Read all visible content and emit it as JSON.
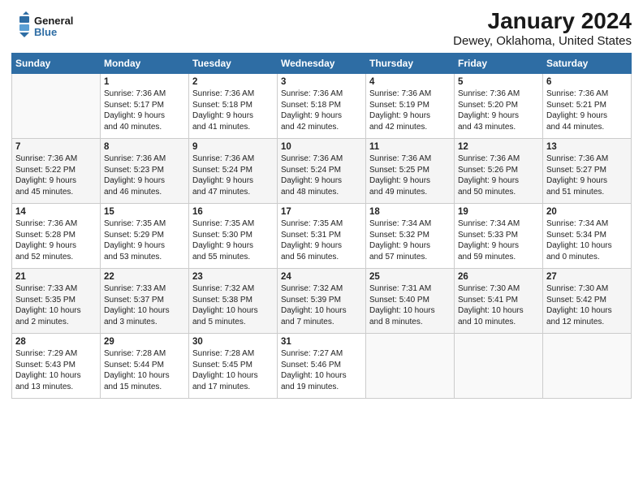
{
  "logo": {
    "line1": "General",
    "line2": "Blue"
  },
  "title": "January 2024",
  "subtitle": "Dewey, Oklahoma, United States",
  "header": {
    "accent_color": "#2e6da4"
  },
  "days_of_week": [
    "Sunday",
    "Monday",
    "Tuesday",
    "Wednesday",
    "Thursday",
    "Friday",
    "Saturday"
  ],
  "weeks": [
    [
      {
        "day": "",
        "content": ""
      },
      {
        "day": "1",
        "content": "Sunrise: 7:36 AM\nSunset: 5:17 PM\nDaylight: 9 hours\nand 40 minutes."
      },
      {
        "day": "2",
        "content": "Sunrise: 7:36 AM\nSunset: 5:18 PM\nDaylight: 9 hours\nand 41 minutes."
      },
      {
        "day": "3",
        "content": "Sunrise: 7:36 AM\nSunset: 5:18 PM\nDaylight: 9 hours\nand 42 minutes."
      },
      {
        "day": "4",
        "content": "Sunrise: 7:36 AM\nSunset: 5:19 PM\nDaylight: 9 hours\nand 42 minutes."
      },
      {
        "day": "5",
        "content": "Sunrise: 7:36 AM\nSunset: 5:20 PM\nDaylight: 9 hours\nand 43 minutes."
      },
      {
        "day": "6",
        "content": "Sunrise: 7:36 AM\nSunset: 5:21 PM\nDaylight: 9 hours\nand 44 minutes."
      }
    ],
    [
      {
        "day": "7",
        "content": "Sunrise: 7:36 AM\nSunset: 5:22 PM\nDaylight: 9 hours\nand 45 minutes."
      },
      {
        "day": "8",
        "content": "Sunrise: 7:36 AM\nSunset: 5:23 PM\nDaylight: 9 hours\nand 46 minutes."
      },
      {
        "day": "9",
        "content": "Sunrise: 7:36 AM\nSunset: 5:24 PM\nDaylight: 9 hours\nand 47 minutes."
      },
      {
        "day": "10",
        "content": "Sunrise: 7:36 AM\nSunset: 5:24 PM\nDaylight: 9 hours\nand 48 minutes."
      },
      {
        "day": "11",
        "content": "Sunrise: 7:36 AM\nSunset: 5:25 PM\nDaylight: 9 hours\nand 49 minutes."
      },
      {
        "day": "12",
        "content": "Sunrise: 7:36 AM\nSunset: 5:26 PM\nDaylight: 9 hours\nand 50 minutes."
      },
      {
        "day": "13",
        "content": "Sunrise: 7:36 AM\nSunset: 5:27 PM\nDaylight: 9 hours\nand 51 minutes."
      }
    ],
    [
      {
        "day": "14",
        "content": "Sunrise: 7:36 AM\nSunset: 5:28 PM\nDaylight: 9 hours\nand 52 minutes."
      },
      {
        "day": "15",
        "content": "Sunrise: 7:35 AM\nSunset: 5:29 PM\nDaylight: 9 hours\nand 53 minutes."
      },
      {
        "day": "16",
        "content": "Sunrise: 7:35 AM\nSunset: 5:30 PM\nDaylight: 9 hours\nand 55 minutes."
      },
      {
        "day": "17",
        "content": "Sunrise: 7:35 AM\nSunset: 5:31 PM\nDaylight: 9 hours\nand 56 minutes."
      },
      {
        "day": "18",
        "content": "Sunrise: 7:34 AM\nSunset: 5:32 PM\nDaylight: 9 hours\nand 57 minutes."
      },
      {
        "day": "19",
        "content": "Sunrise: 7:34 AM\nSunset: 5:33 PM\nDaylight: 9 hours\nand 59 minutes."
      },
      {
        "day": "20",
        "content": "Sunrise: 7:34 AM\nSunset: 5:34 PM\nDaylight: 10 hours\nand 0 minutes."
      }
    ],
    [
      {
        "day": "21",
        "content": "Sunrise: 7:33 AM\nSunset: 5:35 PM\nDaylight: 10 hours\nand 2 minutes."
      },
      {
        "day": "22",
        "content": "Sunrise: 7:33 AM\nSunset: 5:37 PM\nDaylight: 10 hours\nand 3 minutes."
      },
      {
        "day": "23",
        "content": "Sunrise: 7:32 AM\nSunset: 5:38 PM\nDaylight: 10 hours\nand 5 minutes."
      },
      {
        "day": "24",
        "content": "Sunrise: 7:32 AM\nSunset: 5:39 PM\nDaylight: 10 hours\nand 7 minutes."
      },
      {
        "day": "25",
        "content": "Sunrise: 7:31 AM\nSunset: 5:40 PM\nDaylight: 10 hours\nand 8 minutes."
      },
      {
        "day": "26",
        "content": "Sunrise: 7:30 AM\nSunset: 5:41 PM\nDaylight: 10 hours\nand 10 minutes."
      },
      {
        "day": "27",
        "content": "Sunrise: 7:30 AM\nSunset: 5:42 PM\nDaylight: 10 hours\nand 12 minutes."
      }
    ],
    [
      {
        "day": "28",
        "content": "Sunrise: 7:29 AM\nSunset: 5:43 PM\nDaylight: 10 hours\nand 13 minutes."
      },
      {
        "day": "29",
        "content": "Sunrise: 7:28 AM\nSunset: 5:44 PM\nDaylight: 10 hours\nand 15 minutes."
      },
      {
        "day": "30",
        "content": "Sunrise: 7:28 AM\nSunset: 5:45 PM\nDaylight: 10 hours\nand 17 minutes."
      },
      {
        "day": "31",
        "content": "Sunrise: 7:27 AM\nSunset: 5:46 PM\nDaylight: 10 hours\nand 19 minutes."
      },
      {
        "day": "",
        "content": ""
      },
      {
        "day": "",
        "content": ""
      },
      {
        "day": "",
        "content": ""
      }
    ]
  ]
}
